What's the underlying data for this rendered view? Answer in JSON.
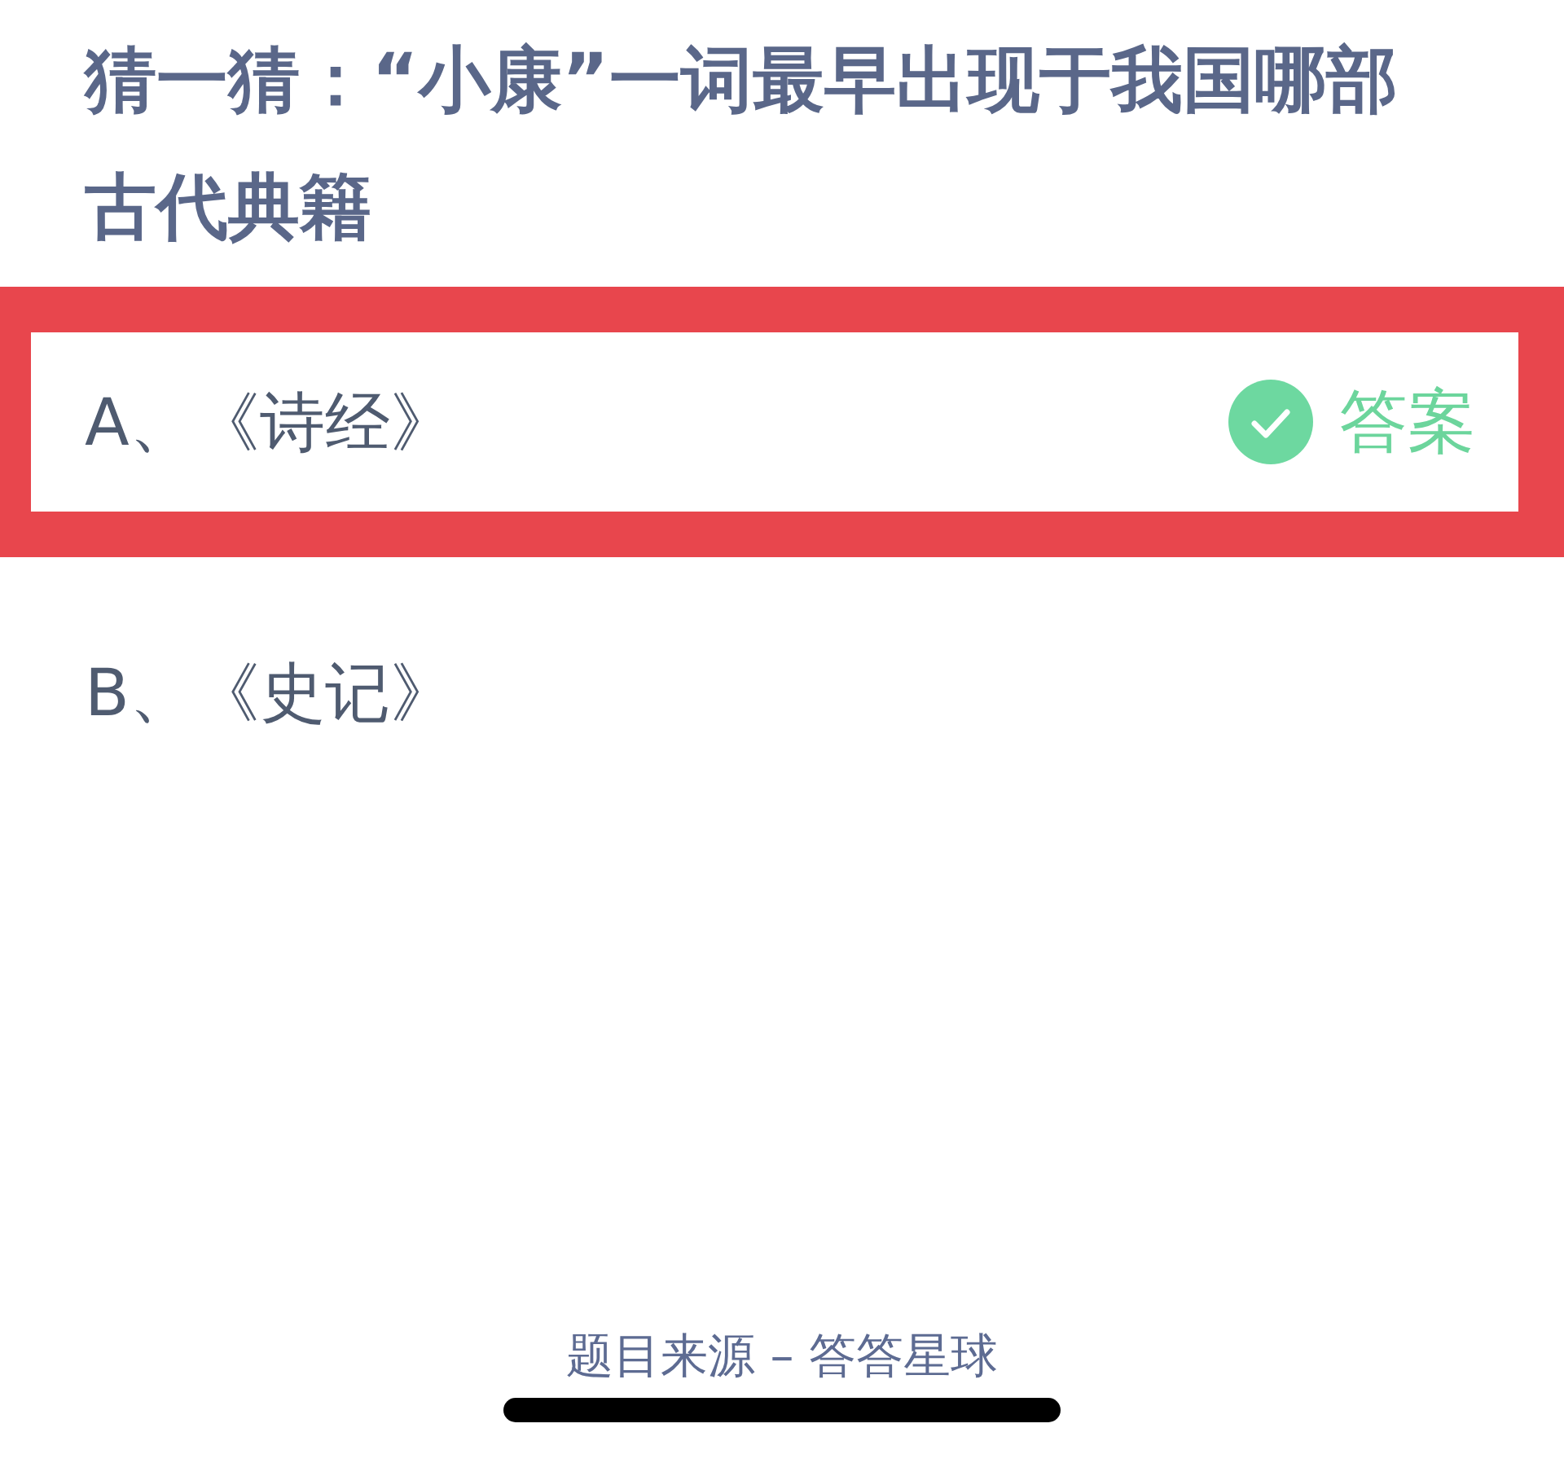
{
  "question": {
    "title": "猜一猜：“小康”一词最早出现于我国哪部古代典籍"
  },
  "options": [
    {
      "label": "A、《诗经》",
      "highlighted": true,
      "correct": true,
      "answer_label": "答案"
    },
    {
      "label": "B、《史记》",
      "highlighted": false,
      "correct": false
    }
  ],
  "footer": {
    "source": "题目来源 – 答答星球"
  }
}
